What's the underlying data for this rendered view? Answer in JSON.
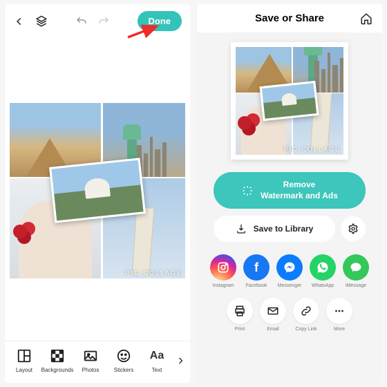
{
  "left": {
    "done_label": "Done",
    "watermark": "PIC·COLLAGE",
    "tools": [
      {
        "id": "layout",
        "label": "Layout"
      },
      {
        "id": "backgrounds",
        "label": "Backgrounds"
      },
      {
        "id": "photos",
        "label": "Photos"
      },
      {
        "id": "stickers",
        "label": "Stickers"
      },
      {
        "id": "text",
        "label": "Text"
      }
    ],
    "collage_photos": [
      "pyramids-sphinx",
      "statue-of-liberty-skyline",
      "decorated-arch",
      "leaning-tower-pisa",
      "taj-mahal-overlay"
    ]
  },
  "right": {
    "title": "Save or Share",
    "remove_btn": "Remove\nWatermark and Ads",
    "save_btn": "Save to Library",
    "share_apps": [
      {
        "id": "instagram",
        "label": "Instagram"
      },
      {
        "id": "facebook",
        "label": "Facebook"
      },
      {
        "id": "messenger",
        "label": "Messenger"
      },
      {
        "id": "whatsapp",
        "label": "WhatsApp"
      },
      {
        "id": "imessage",
        "label": "iMessage"
      }
    ],
    "actions": [
      {
        "id": "print",
        "label": "Print",
        "glyph": "print"
      },
      {
        "id": "email",
        "label": "Email",
        "glyph": "mail"
      },
      {
        "id": "copylink",
        "label": "Copy Link",
        "glyph": "link"
      },
      {
        "id": "more",
        "label": "More",
        "glyph": "dots"
      }
    ]
  },
  "colors": {
    "accent": "#34c3b8"
  }
}
